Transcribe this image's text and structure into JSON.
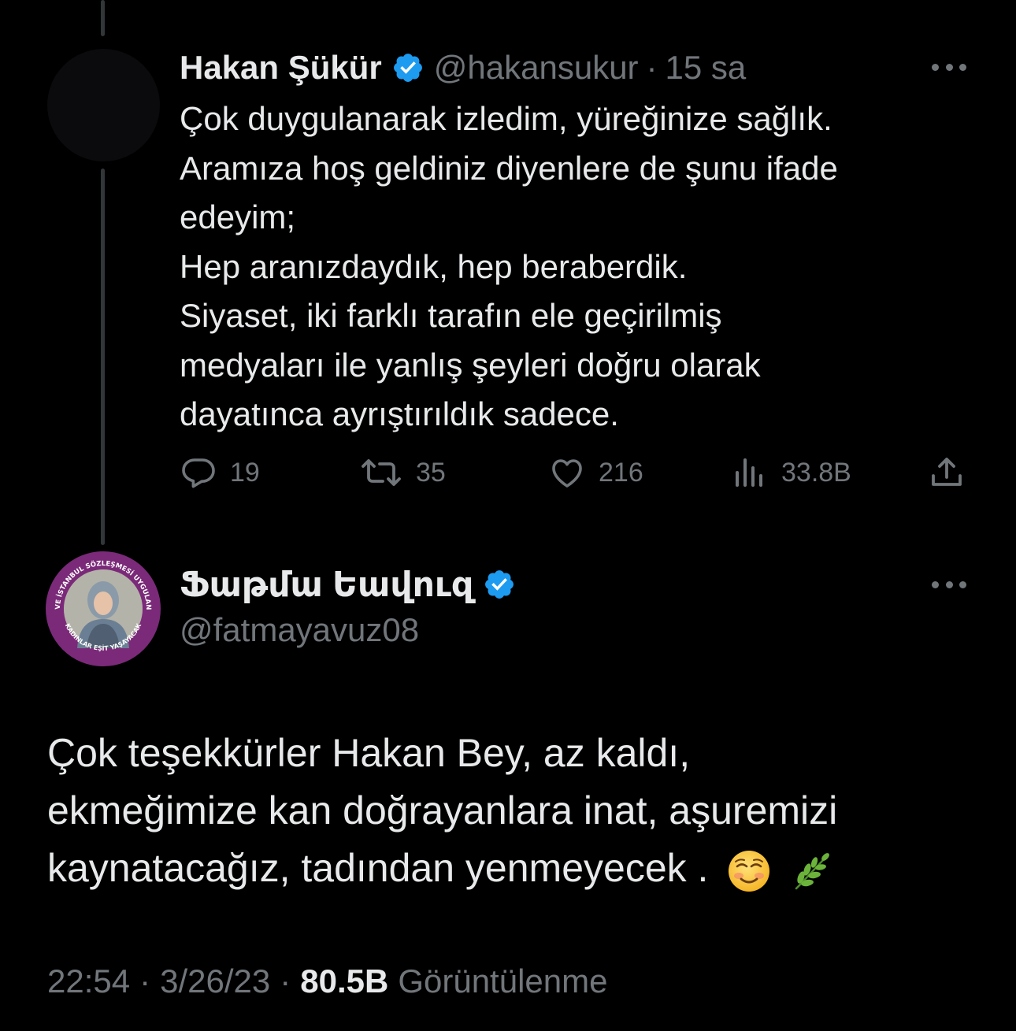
{
  "colors": {
    "background": "#000000",
    "text": "#e7e9ea",
    "muted": "#71767b",
    "verified": "#1d9bf0",
    "thread_line": "#333639"
  },
  "tweet1": {
    "name": "Hakan Şükür",
    "handle": "@hakansukur",
    "dot": "·",
    "time": "15 sa",
    "verified_icon": "verified-badge-icon",
    "more_icon": "more-icon",
    "lines": [
      "Çok duygulanarak izledim, yüreğinize sağlık.",
      "Aramıza hoş geldiniz diyenlere de şunu ifade",
      "edeyim;",
      "Hep aranızdaydık, hep beraberdik.",
      "Siyaset, iki farklı tarafın ele geçirilmiş",
      "medyaları ile yanlış şeyleri doğru olarak",
      "dayatınca ayrıştırıldık sadece."
    ],
    "actions": {
      "reply_count": "19",
      "retweet_count": "35",
      "like_count": "216",
      "views_count": "33.8B"
    }
  },
  "tweet2": {
    "name": "Ֆաթմա Եավուզ",
    "handle": "@fatmayavuz08",
    "avatar_ring_text": "6284 VE İSTANBUL SÖZLEŞMESİ UYGULANACAK · KADINLAR EŞİT YAŞAYACAK",
    "lines": [
      "Çok teşekkürler Hakan Bey, az kaldı,",
      "ekmeğimize kan doğrayanlara inat, aşuremizi",
      "kaynatacağız, tadından yenmeyecek ."
    ],
    "emojis": [
      "smiling-face-icon",
      "herb-icon"
    ],
    "meta": {
      "time": "22:54",
      "dot": "·",
      "date": "3/26/23",
      "views": "80.5B",
      "views_label": "Görüntülenme"
    }
  }
}
